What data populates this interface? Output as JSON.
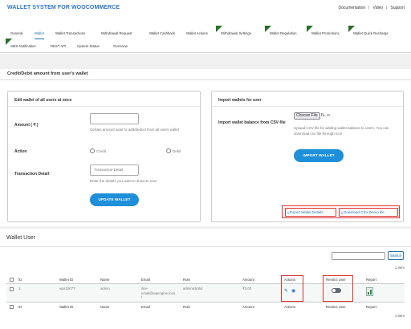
{
  "app": {
    "title": "WALLET SYSTEM FOR WOOCOMMERCE"
  },
  "top_links": {
    "documentation": "Documentation",
    "video": "Video",
    "support": "Support",
    "separator": "|"
  },
  "tabs": [
    {
      "label": "General",
      "new": false,
      "active": false
    },
    {
      "label": "Wallet",
      "new": false,
      "active": true
    },
    {
      "label": "Wallet Transactions",
      "new": false,
      "active": false
    },
    {
      "label": "Withdrawal Request",
      "new": false,
      "active": false
    },
    {
      "label": "Wallet Cashback",
      "new": false,
      "active": false
    },
    {
      "label": "Wallet Actions",
      "new": false,
      "active": false
    },
    {
      "label": "Withdrawal Settings",
      "new": true,
      "active": false
    },
    {
      "label": "Wallet Regulation",
      "new": true,
      "active": false
    },
    {
      "label": "Wallet Promotions",
      "new": true,
      "active": false
    },
    {
      "label": "Wallet Quick Recharge",
      "new": true,
      "active": false
    },
    {
      "label": "SMS Notification",
      "new": true,
      "active": false
    },
    {
      "label": "REST API",
      "new": false,
      "active": false
    },
    {
      "label": "System Status",
      "new": false,
      "active": false
    },
    {
      "label": "Overview",
      "new": false,
      "active": false
    }
  ],
  "credit_section": {
    "title": "Credit/Debit amount from user's wallet"
  },
  "edit_all": {
    "title": "Edit wallet of all users at once",
    "amount_label": "Amount ( ₹ )",
    "amount_value": "",
    "amount_help": "Certain amount want to add/deduct from all users wallet",
    "action_label": "Action",
    "credit_option": "Credit",
    "debit_option": "Debit",
    "detail_label": "Transaction Detail",
    "detail_placeholder": "Transaction Detail",
    "detail_help": "Enter the details you want to show to user",
    "update_button": "UPDATE WALLET"
  },
  "import": {
    "title": "Import wallets for user",
    "balance_label": "Import wallet balance from CSV file",
    "choose_file": "Choose File",
    "file_status": "N...n",
    "help": "Upload CSV file for adding wallet balance to users. You can download csv file through icon",
    "import_button": "IMPORT WALLET",
    "export_details": "Export Wallet Details",
    "download_demo": "Download CSV Demo file"
  },
  "wallet_user": {
    "title": "Wallet User",
    "search_button": "Search",
    "search_value": "",
    "items_count": "1 item",
    "columns": [
      "ID",
      "Wallet ID",
      "Name",
      "Email",
      "Role",
      "Amount",
      "Actions",
      "Restrict User",
      "Report"
    ],
    "rows": [
      {
        "id": "1",
        "wallet_id": "wps1b077",
        "name": "admin",
        "email_line1": "dev-",
        "email_line2": "email@wpengine.loca",
        "email_line3": "l",
        "role": "administrator",
        "amount": "₹0.00"
      }
    ]
  },
  "colors": {
    "brand": "#2f76c7",
    "primary_button": "#1e8fd9",
    "highlight": "#e03131",
    "new_flag": "#2b6f2b"
  },
  "icons": [
    "download-icon",
    "edit-icon",
    "view-icon",
    "report-icon",
    "toggle-icon"
  ]
}
